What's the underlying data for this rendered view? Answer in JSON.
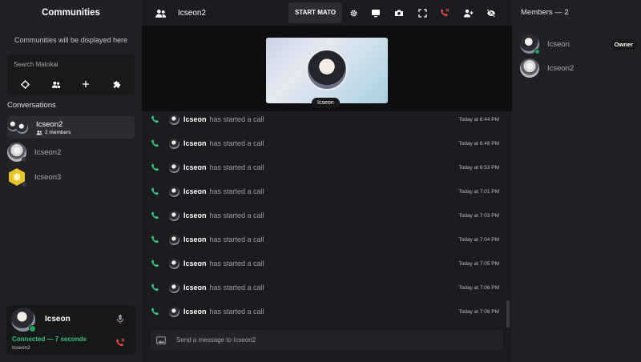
{
  "sidebar": {
    "title": "Communities",
    "empty_text": "Communities will be displayed here",
    "search_placeholder": "Search Matokai",
    "quick_icons": [
      "tag-icon",
      "friends-icon",
      "plus-icon",
      "puzzle-icon"
    ],
    "conversations_label": "Conversations",
    "conversations": [
      {
        "name": "Icseon2",
        "subtitle": "2 members",
        "icon": "group-avatar",
        "active": true
      },
      {
        "name": "Icseon2",
        "icon": "avatar",
        "active": false
      },
      {
        "name": "Icseon3",
        "icon": "hexagon-avatar",
        "active": false
      }
    ]
  },
  "user_panel": {
    "username": "Icseon",
    "connection_status": "Connected — 7 seconds",
    "room": "Icseon2"
  },
  "header": {
    "title": "Icseon2",
    "start_button": "START MATO",
    "icons": [
      "settings-icon",
      "screen-share-icon",
      "camera-icon",
      "fullscreen-icon",
      "hang-up-icon",
      "add-user-icon",
      "hide-icon"
    ]
  },
  "call": {
    "participant_name": "Icseon"
  },
  "messages": [
    {
      "author": "Icseon",
      "text": "has started a call",
      "time": "Today at 6:44 PM"
    },
    {
      "author": "Icseon",
      "text": "has started a call",
      "time": "Today at 6:48 PM"
    },
    {
      "author": "Icseon",
      "text": "has started a call",
      "time": "Today at 6:53 PM"
    },
    {
      "author": "Icseon",
      "text": "has started a call",
      "time": "Today at 7:01 PM"
    },
    {
      "author": "Icseon",
      "text": "has started a call",
      "time": "Today at 7:03 PM"
    },
    {
      "author": "Icseon",
      "text": "has started a call",
      "time": "Today at 7:04 PM"
    },
    {
      "author": "Icseon",
      "text": "has started a call",
      "time": "Today at 7:05 PM"
    },
    {
      "author": "Icseon",
      "text": "has started a call",
      "time": "Today at 7:06 PM"
    },
    {
      "author": "Icseon",
      "text": "has started a call",
      "time": "Today at 7:08 PM"
    }
  ],
  "composer": {
    "placeholder": "Send a message to Icseon2"
  },
  "members": {
    "title": "Members — 2",
    "list": [
      {
        "name": "Icseon",
        "badge": "Owner",
        "online": true
      },
      {
        "name": "Icseon2",
        "badge": "",
        "online": false
      }
    ]
  },
  "colors": {
    "accent_green": "#3ec07a",
    "hangup_red": "#e0484a",
    "online": "#23a559"
  }
}
